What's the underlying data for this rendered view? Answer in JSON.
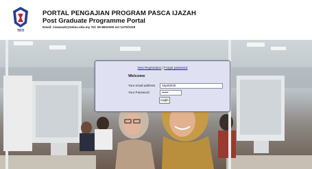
{
  "header": {
    "title_malay": "PORTAL PENGAJIAN PROGRAM PASCA IJAZAH",
    "title_english": "Post Graduate Programme Portal",
    "contact": "Email: siswazah@tatiuc.edu.my Tel: 09-8601000 ext 1475/1028",
    "logo_text": "TATI"
  },
  "login": {
    "link_register": "New Registration",
    "link_separator": "|",
    "link_forgot": "Forgot password",
    "welcome": "Welcome",
    "email_label": "Your email address",
    "email_value": "16p05030",
    "password_label": "Your Password",
    "password_value": "••••••",
    "login_button": "Login"
  },
  "colors": {
    "login_panel_bg": "#dfe1f2",
    "link_color": "#1c1c8e",
    "logo_blue": "#2a3e8c",
    "logo_red": "#c8202a"
  },
  "icons": {
    "logo": "university-shield-logo"
  }
}
